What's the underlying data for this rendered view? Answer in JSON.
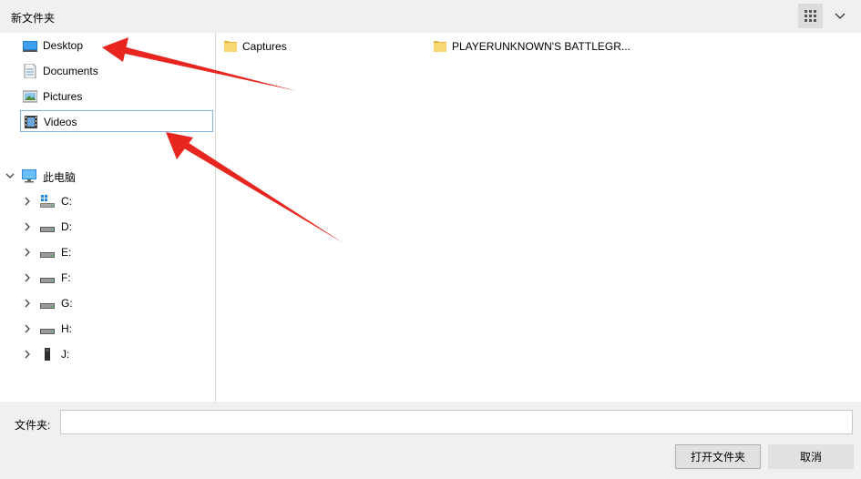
{
  "window": {
    "title": "新文件夹"
  },
  "toolbar": {
    "view_icon": "grid-view-icon",
    "dropdown_icon": "chevron-down-icon"
  },
  "nav": {
    "quick_access": [
      {
        "label": "Desktop",
        "icon": "desktop-icon"
      },
      {
        "label": "Documents",
        "icon": "documents-icon"
      },
      {
        "label": "Pictures",
        "icon": "pictures-icon"
      },
      {
        "label": "Videos",
        "icon": "videos-icon",
        "selected": true
      }
    ],
    "this_pc": {
      "label": "此电脑",
      "icon": "computer-icon"
    },
    "drives": [
      {
        "label": "C:",
        "icon": "windows-drive-icon"
      },
      {
        "label": "D:",
        "icon": "drive-icon"
      },
      {
        "label": "E:",
        "icon": "drive-icon"
      },
      {
        "label": "F:",
        "icon": "drive-icon"
      },
      {
        "label": "G:",
        "icon": "drive-icon"
      },
      {
        "label": "H:",
        "icon": "drive-icon"
      },
      {
        "label": "J:",
        "icon": "usb-drive-icon"
      }
    ]
  },
  "files": [
    {
      "label": "Captures",
      "icon": "folder-icon"
    },
    {
      "label": "PLAYERUNKNOWN'S BATTLEGR...",
      "icon": "folder-icon"
    }
  ],
  "footer": {
    "folder_label": "文件夹:",
    "folder_value": "",
    "open_button": "打开文件夹",
    "cancel_button": "取消"
  },
  "annotations": {
    "arrow_color": "#e8251e"
  }
}
